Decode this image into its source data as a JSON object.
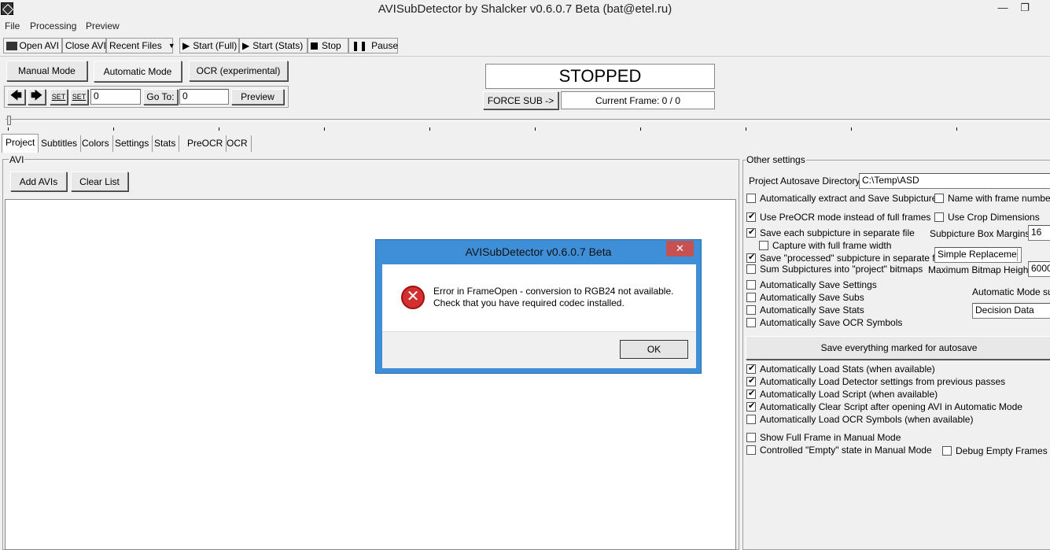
{
  "window": {
    "title": "AVISubDetector by Shalcker v0.6.0.7 Beta (bat@etel.ru)",
    "minimize": "—",
    "maximize": "❐"
  },
  "menu": [
    "File",
    "Processing",
    "Preview"
  ],
  "toolbar": {
    "open_avi": "Open AVI",
    "close_avi": "Close AVI",
    "recent_files": "Recent Files",
    "start_full": "Start (Full)",
    "start_stats": "Start (Stats)",
    "stop": "Stop",
    "pause": "Pause"
  },
  "modes": {
    "manual": "Manual Mode",
    "automatic": "Automatic Mode",
    "ocr": "OCR (experimental)"
  },
  "nav": {
    "set1": "SET",
    "set2": "SET",
    "frame_value": "0",
    "goto_label": "Go To:",
    "goto_value": "0",
    "preview": "Preview"
  },
  "status": {
    "state": "STOPPED",
    "force_sub": "FORCE SUB ->",
    "current_frame": "Current Frame: 0 / 0"
  },
  "tabs": [
    "Project",
    "Subtitles",
    "Colors",
    "Settings",
    "Stats",
    "PreOCR",
    "OCR"
  ],
  "avi_panel": {
    "label": "AVI",
    "add_avis": "Add AVIs",
    "clear_list": "Clear List"
  },
  "other_settings": {
    "label": "Other settings",
    "autosave_dir_label": "Project Autosave Directory:",
    "autosave_dir_value": "C:\\Temp\\ASD",
    "auto_extract": "Automatically extract and Save Subpictures",
    "name_frame_number": "Name with frame number fir",
    "use_preocr": "Use PreOCR mode instead of full frames",
    "use_crop": "Use Crop Dimensions",
    "save_each_subpicture": "Save each subpicture in separate file",
    "subpicture_margins_label": "Subpicture Box Margins:",
    "subpicture_margins_value": "16",
    "capture_full_width": "Capture with full frame width",
    "save_processed": "Save \"processed\" subpicture in separate file",
    "replace_mode": "Simple Replaceme",
    "sum_subpictures": "Sum Subpictures into \"project\" bitmaps",
    "max_bitmap_label": "Maximum Bitmap Height:",
    "max_bitmap_value": "6000",
    "auto_save_settings": "Automatically Save Settings",
    "auto_save_subs": "Automatically Save Subs",
    "auto_save_stats": "Automatically Save Stats",
    "auto_save_ocr": "Automatically Save OCR Symbols",
    "auto_mode_subs_label": "Automatic Mode subs",
    "decision_data": "Decision Data",
    "save_everything": "Save everything marked for autosave",
    "auto_load_stats": "Automatically Load Stats (when available)",
    "auto_load_detector": "Automatically Load Detector settings from previous passes",
    "auto_load_script": "Automatically Load Script (when available)",
    "auto_clear_script": "Automatically Clear Script after opening AVI in Automatic Mode",
    "auto_load_ocr": "Automatically Load OCR Symbols (when available)",
    "show_full_frame": "Show Full Frame in Manual Mode",
    "controlled_empty": "Controlled \"Empty\" state in Manual Mode",
    "debug_empty": "Debug Empty Frames"
  },
  "dialog": {
    "title": "AVISubDetector v0.6.0.7 Beta",
    "close": "✕",
    "line1": "Error in FrameOpen - conversion to RGB24 not available.",
    "line2": "Check that you have required codec installed.",
    "ok": "OK"
  }
}
